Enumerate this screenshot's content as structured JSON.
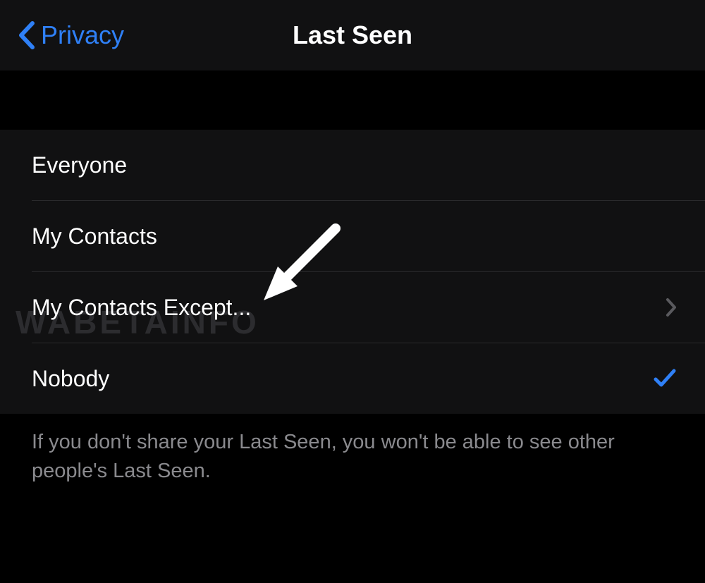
{
  "navbar": {
    "back_label": "Privacy",
    "title": "Last Seen"
  },
  "options": {
    "item0": {
      "label": "Everyone"
    },
    "item1": {
      "label": "My Contacts"
    },
    "item2": {
      "label": "My Contacts Except..."
    },
    "item3": {
      "label": "Nobody"
    }
  },
  "footer": {
    "text": "If you don't share your Last Seen, you won't be able to see other people's Last Seen."
  },
  "watermark": "WABETAINFO"
}
